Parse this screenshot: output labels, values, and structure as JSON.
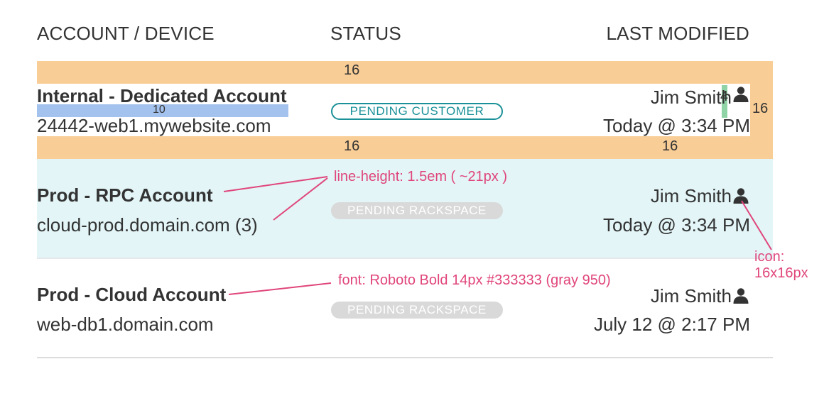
{
  "header": {
    "col_account": "ACCOUNT / DEVICE",
    "col_status": "STATUS",
    "col_modified": "LAST MODIFIED"
  },
  "rows": [
    {
      "account": "Internal - Dedicated Account",
      "device": "24442-web1.mywebsite.com",
      "status": "PENDING CUSTOMER",
      "user": "Jim Smith",
      "modified": "Today @ 3:34 PM"
    },
    {
      "account": "Prod - RPC Account",
      "device": "cloud-prod.domain.com (3)",
      "status": "PENDING RACKSPACE",
      "user": "Jim Smith",
      "modified": "Today @ 3:34 PM"
    },
    {
      "account": "Prod - Cloud Account",
      "device": "web-db1.domain.com",
      "status": "PENDING RACKSPACE",
      "user": "Jim Smith",
      "modified": "July 12 @ 2:17 PM"
    }
  ],
  "spec": {
    "pad_top": "16",
    "pad_bottom_left": "16",
    "pad_bottom_right": "16",
    "pad_right": "16",
    "line_gap": "10",
    "icon_gap": "4",
    "line_height_note": "line-height: 1.5em ( ~21px )",
    "font_note": "font: Roboto Bold 14px #333333 (gray 950)",
    "icon_note_1": "icon:",
    "icon_note_2": "16x16px"
  },
  "colors": {
    "text": "#333333",
    "padding_overlay": "#f9cd96",
    "gap_overlay": "#a4c2ee",
    "icon_gap_overlay": "#8fd3a6",
    "selected_row_bg": "#e3f5f7",
    "badge_customer": "#1a9098",
    "badge_rackspace_bg": "#d9d9d9",
    "annotation": "#e0457b",
    "divider": "#dcdcdc"
  },
  "icons": {
    "user": "user-icon"
  }
}
